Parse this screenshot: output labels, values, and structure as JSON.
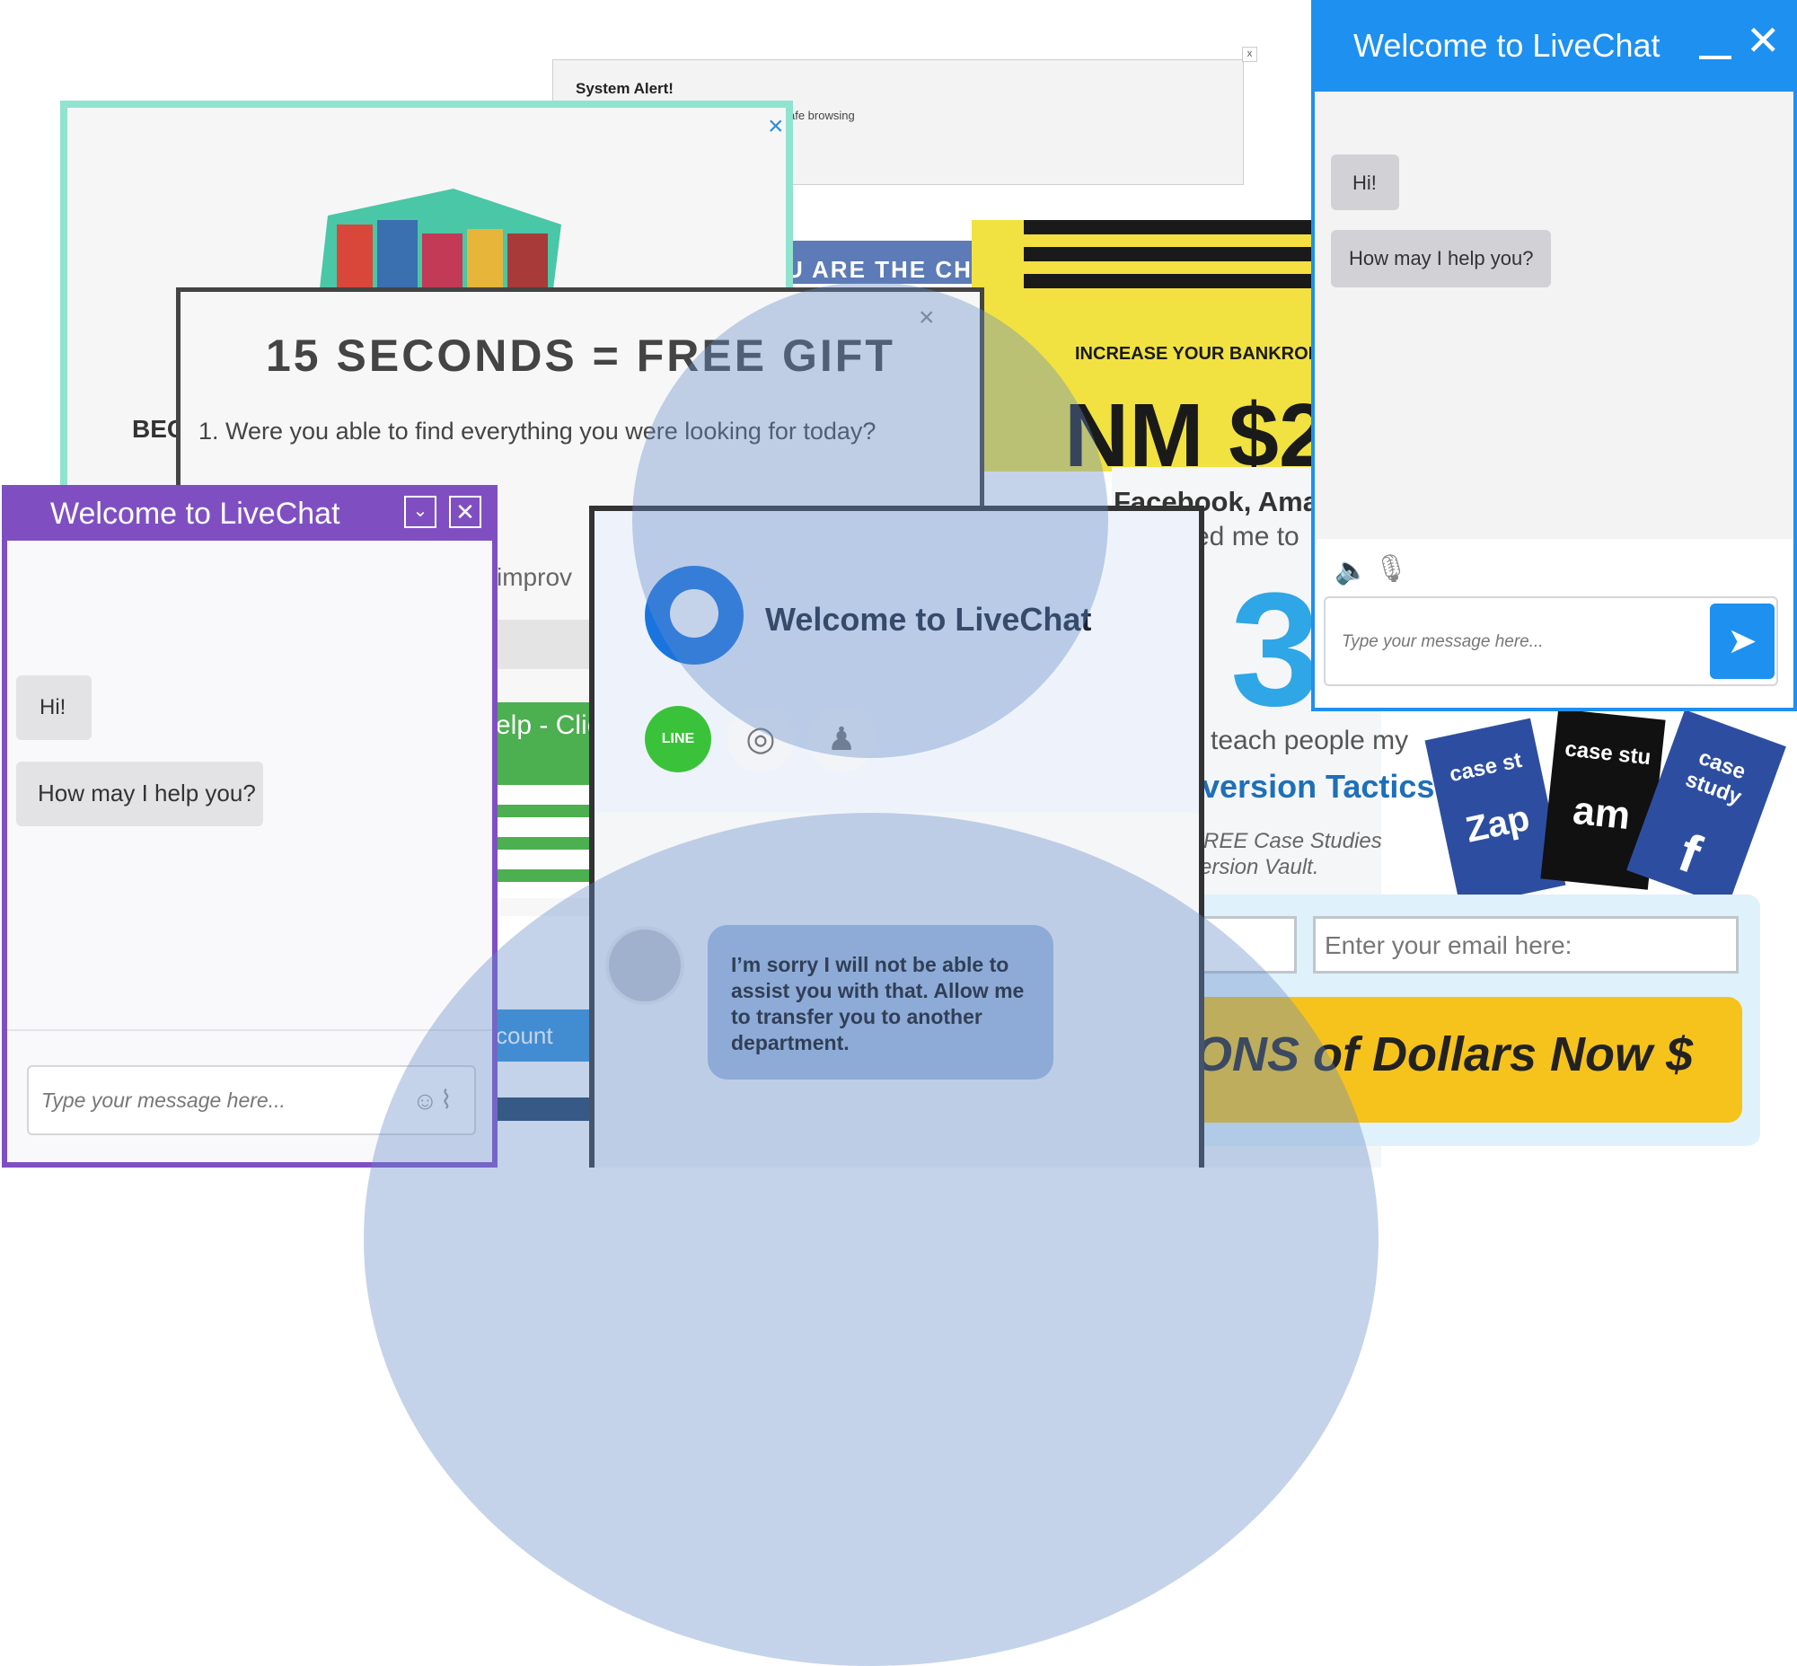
{
  "system_alert": {
    "title": "System Alert!",
    "body": "afe browsing",
    "close": "x"
  },
  "snack_popup": {
    "close": "×",
    "partial_heading": "BEC"
  },
  "behind_ads": {
    "banner_text": "U ARE THE CHO",
    "bankroll": "INCREASE YOUR BANKROLL",
    "bankroll_big": "NM $25",
    "facebook_line": "Facebook, Ama",
    "ed_line": "ed me to",
    "digit": "3",
    "teach_line": "teach people my",
    "tactics": "version Tactics.",
    "free_cases": "REE Case Studies",
    "vault": "ersion Vault.",
    "email_placeholder": "Enter your email here:",
    "cta": "ONS of Dollars Now $",
    "case_labels": [
      "case st",
      "case stu",
      "case study"
    ],
    "case_brands": [
      "Zap",
      "am",
      "f"
    ]
  },
  "gift_popup": {
    "close": "×",
    "title": "15 SECONDS = FREE GIFT",
    "question": "1. Were you able to find everything you were looking for today?",
    "improve": "improv",
    "help_button": "elp - Clic",
    "account": "count"
  },
  "purple_chat": {
    "title": "Welcome to LiveChat",
    "min_icon": "⌄",
    "close_icon": "✕",
    "messages": [
      "Hi!",
      "How may I help you?"
    ],
    "input_placeholder": "Type your message here...",
    "accent": "#7f4fc2"
  },
  "center_chat": {
    "title": "Welcome to LiveChat",
    "social": [
      "LINE",
      "instagram-icon",
      "snapchat-icon"
    ],
    "message": "I’m sorry I will not be able to assist you with that. Allow me to transfer you to another department."
  },
  "blue_chat": {
    "title": "Welcome to LiveChat",
    "messages": [
      "Hi!",
      "How may I help you?"
    ],
    "input_placeholder": "Type your message here...",
    "send_icon": "➤",
    "accent": "#1e90f0"
  }
}
